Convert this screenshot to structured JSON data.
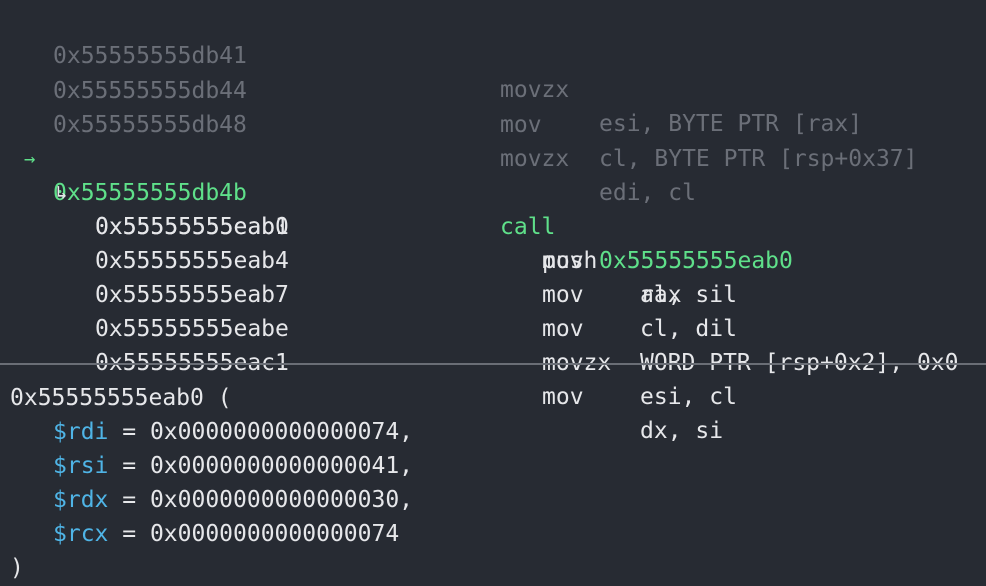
{
  "colors": {
    "background": "#272b33",
    "text": "#e6e7ea",
    "dimmed": "#6b6f78",
    "current": "#5fe08a",
    "register": "#4fb4e6",
    "divider": "#6a6e76"
  },
  "disasm": {
    "previous": [
      {
        "addr": "0x55555555db41",
        "mnemonic": "movzx",
        "operands": "esi, BYTE PTR [rax]"
      },
      {
        "addr": "0x55555555db44",
        "mnemonic": "mov",
        "operands": "cl, BYTE PTR [rsp+0x37]"
      },
      {
        "addr": "0x55555555db48",
        "mnemonic": "movzx",
        "operands": "edi, cl"
      }
    ],
    "current": {
      "marker": "→",
      "addr": "0x55555555db4b",
      "mnemonic": "call",
      "operands": "0x55555555eab0"
    },
    "callee": [
      {
        "marker": "↳",
        "addr": "0x55555555eab0",
        "mnemonic": "push",
        "operands": "rax"
      },
      {
        "addr": "0x55555555eab1",
        "mnemonic": "mov",
        "operands": "al, sil"
      },
      {
        "addr": "0x55555555eab4",
        "mnemonic": "mov",
        "operands": "cl, dil"
      },
      {
        "addr": "0x55555555eab7",
        "mnemonic": "mov",
        "operands": "WORD PTR [rsp+0x2], 0x0"
      },
      {
        "addr": "0x55555555eabe",
        "mnemonic": "movzx",
        "operands": "esi, cl"
      },
      {
        "addr": "0x55555555eac1",
        "mnemonic": "mov",
        "operands": "dx, si"
      }
    ]
  },
  "call_args": {
    "header": "0x55555555eab0 (",
    "args": [
      {
        "reg": "$rdi",
        "eq": " = ",
        "value": "0x0000000000000074,"
      },
      {
        "reg": "$rsi",
        "eq": " = ",
        "value": "0x0000000000000041,"
      },
      {
        "reg": "$rdx",
        "eq": " = ",
        "value": "0x0000000000000030,"
      },
      {
        "reg": "$rcx",
        "eq": " = ",
        "value": "0x0000000000000074"
      }
    ],
    "footer": ")"
  }
}
